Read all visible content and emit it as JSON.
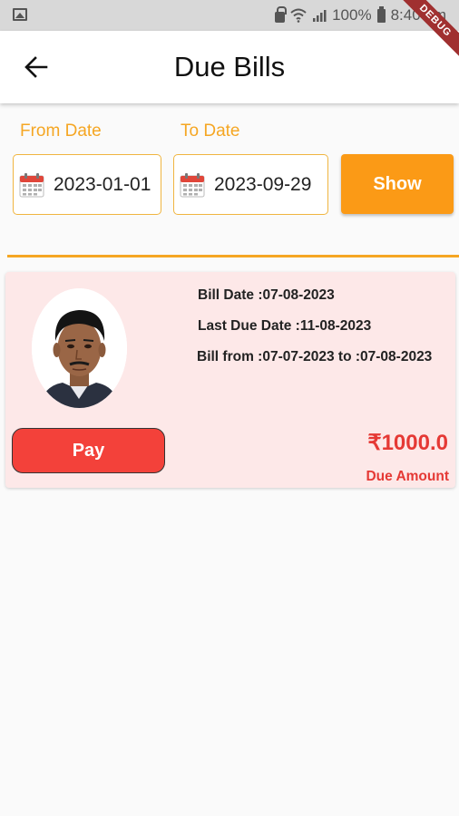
{
  "status_bar": {
    "battery": "100%",
    "time": "8:40 pm"
  },
  "debug_banner": "DEBUG",
  "app_bar": {
    "title": "Due Bills"
  },
  "filter": {
    "from_label": "From Date",
    "from_value": "2023-01-01",
    "to_label": "To Date",
    "to_value": "2023-09-29",
    "show_label": "Show"
  },
  "bill": {
    "bill_date": "Bill Date :07-08-2023",
    "last_due_date": "Last Due Date :11-08-2023",
    "bill_from": "Bill from :07-07-2023 to :07-08-2023",
    "pay_label": "Pay",
    "amount": "₹1000.0",
    "amount_label": "Due Amount"
  },
  "colors": {
    "accent": "#f5a623",
    "show_button": "#fb9a16",
    "pay_button": "#f3413a",
    "amount": "#e53935",
    "card_bg": "#fde8e8"
  }
}
